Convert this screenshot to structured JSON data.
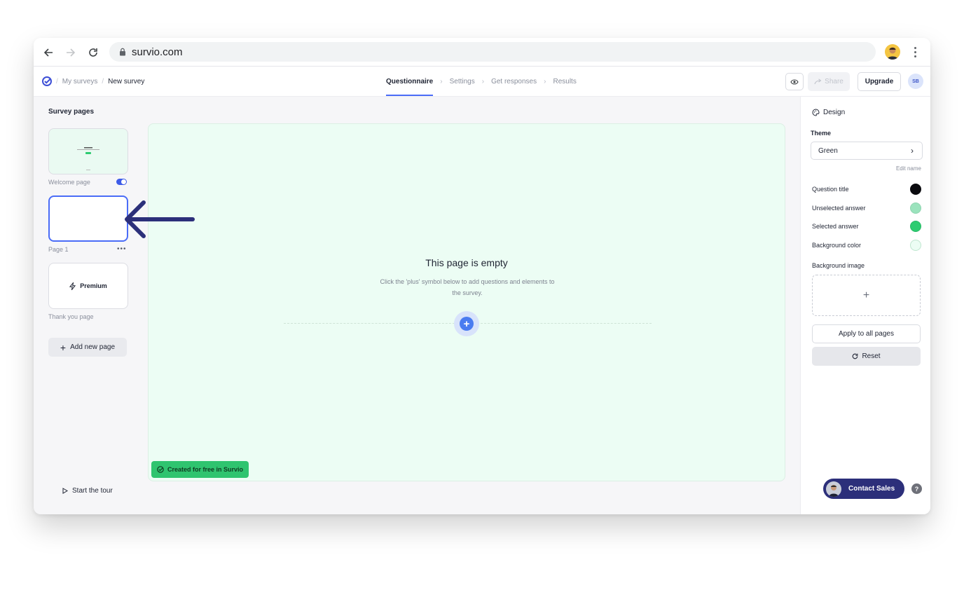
{
  "browser": {
    "url": "survio.com"
  },
  "appbar": {
    "breadcrumb": [
      "My surveys",
      "New survey"
    ],
    "steps": [
      "Questionnaire",
      "Settings",
      "Get responses",
      "Results"
    ],
    "share_label": "Share",
    "upgrade_label": "Upgrade",
    "avatar_initials": "SB"
  },
  "left_panel": {
    "title": "Survey pages",
    "pages": [
      {
        "label": "Welcome page",
        "enabled": true
      },
      {
        "label": "Page 1"
      },
      {
        "label": "Thank you page",
        "content": "Premium"
      }
    ],
    "page_menu": "•••",
    "add_page_label": "Add new page",
    "tour_label": "Start the tour"
  },
  "canvas": {
    "empty_title": "This page is empty",
    "empty_subtitle": "Click the 'plus' symbol below to add questions and elements to the survey.",
    "badge": "Created for free in Survio"
  },
  "design_panel": {
    "title": "Design",
    "theme_label": "Theme",
    "theme_value": "Green",
    "edit_name": "Edit name",
    "colors": [
      {
        "label": "Question title",
        "color": "#0b0b0f"
      },
      {
        "label": "Unselected answer",
        "color": "#9be3bd"
      },
      {
        "label": "Selected answer",
        "color": "#2ecc71"
      },
      {
        "label": "Background color",
        "color": "#ecfdf4"
      }
    ],
    "bg_image_label": "Background image",
    "apply_label": "Apply to all pages",
    "reset_label": "Reset",
    "contact_label": "Contact Sales",
    "help": "?"
  },
  "colors": {
    "accent": "#4a6cf7",
    "canvas_bg": "#ecfdf4",
    "badge_green": "#2fc46f",
    "arrow": "#2c2f7a"
  }
}
